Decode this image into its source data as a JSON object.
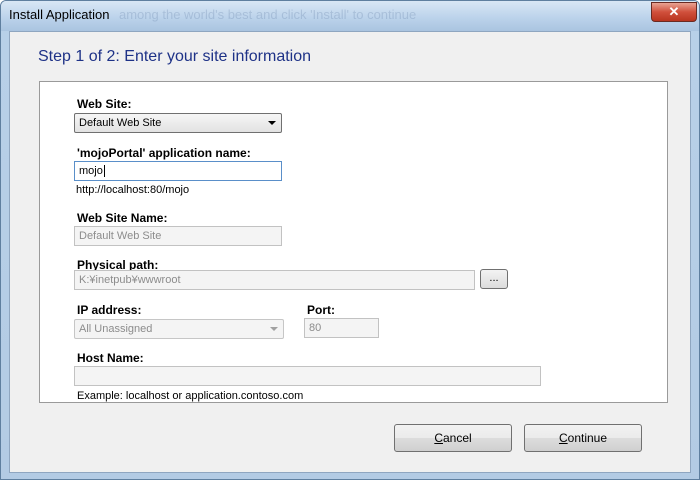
{
  "window": {
    "title": "Install Application",
    "title_overlay": "among the world's best and click 'Install' to continue",
    "close_symbol": "✕"
  },
  "step_title": "Step 1 of 2: Enter your site information",
  "form": {
    "web_site": {
      "label": "Web Site:",
      "value": "Default Web Site"
    },
    "app_name": {
      "label": "'mojoPortal' application name:",
      "value": "mojo",
      "url_preview": "http://localhost:80/mojo"
    },
    "web_site_name": {
      "label": "Web Site Name:",
      "value": "Default Web Site"
    },
    "physical_path": {
      "label": "Physical path:",
      "value": "K:¥inetpub¥wwwroot",
      "browse_label": "..."
    },
    "ip_address": {
      "label": "IP address:",
      "value": "All Unassigned"
    },
    "port": {
      "label": "Port:",
      "value": "80"
    },
    "host_name": {
      "label": "Host Name:",
      "value": "",
      "example": "Example: localhost or application.contoso.com"
    }
  },
  "buttons": {
    "cancel": {
      "label": "Cancel",
      "mnemonic": "C",
      "rest": "ancel"
    },
    "continue": {
      "label": "Continue",
      "mnemonic": "C",
      "rest": "ontinue"
    }
  },
  "colors": {
    "accent_title": "#1e3287",
    "close_button": "#c9452f"
  }
}
